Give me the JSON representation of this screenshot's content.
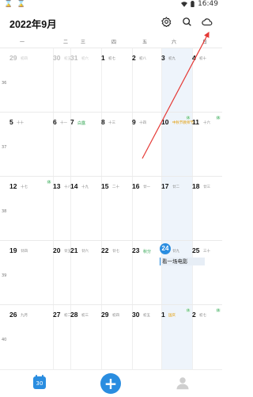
{
  "status_bar": {
    "left_icons": "⌛ ⌛",
    "time": "16:49"
  },
  "header": {
    "title": "2022年9月",
    "icons": [
      "settings-icon",
      "search-icon",
      "cloud-icon"
    ]
  },
  "weekdays": [
    "一",
    "二",
    "三",
    "四",
    "五",
    "六",
    "日"
  ],
  "weeks": [
    {
      "num": "36",
      "days": [
        {
          "day": "29",
          "lunar": "初四",
          "muted": true
        },
        {
          "day": "30",
          "lunar": "初五",
          "muted": true
        },
        {
          "day": "31",
          "lunar": "初六",
          "muted": true
        },
        {
          "day": "1",
          "lunar": "初七"
        },
        {
          "day": "2",
          "lunar": "初八"
        },
        {
          "day": "3",
          "lunar": "初九"
        },
        {
          "day": "4",
          "lunar": "初十"
        }
      ]
    },
    {
      "num": "37",
      "days": [
        {
          "day": "5",
          "lunar": "十十"
        },
        {
          "day": "6",
          "lunar": "十一"
        },
        {
          "day": "7",
          "lunar": "白露",
          "type": "festival"
        },
        {
          "day": "8",
          "lunar": "十三"
        },
        {
          "day": "9",
          "lunar": "十四"
        },
        {
          "day": "10",
          "lunar": "中秋节教师节",
          "type": "holiday",
          "badge": "休",
          "badge_type": "xiu"
        },
        {
          "day": "11",
          "lunar": "十六",
          "badge": "休",
          "badge_type": "xiu"
        }
      ]
    },
    {
      "num": "38",
      "days": [
        {
          "day": "12",
          "lunar": "十七",
          "badge": "休",
          "badge_type": "xiu"
        },
        {
          "day": "13",
          "lunar": "十八"
        },
        {
          "day": "14",
          "lunar": "十九"
        },
        {
          "day": "15",
          "lunar": "二十"
        },
        {
          "day": "16",
          "lunar": "廿一"
        },
        {
          "day": "17",
          "lunar": "廿二"
        },
        {
          "day": "18",
          "lunar": "廿三"
        }
      ]
    },
    {
      "num": "39",
      "days": [
        {
          "day": "19",
          "lunar": "廿四"
        },
        {
          "day": "20",
          "lunar": "廿五"
        },
        {
          "day": "21",
          "lunar": "廿六"
        },
        {
          "day": "22",
          "lunar": "廿七"
        },
        {
          "day": "23",
          "lunar": "秋分",
          "type": "festival"
        },
        {
          "day": "24",
          "lunar": "廿九",
          "today": true,
          "event": "看一场电影"
        },
        {
          "day": "25",
          "lunar": "三十"
        }
      ]
    },
    {
      "num": "40",
      "days": [
        {
          "day": "26",
          "lunar": "九月"
        },
        {
          "day": "27",
          "lunar": "初二"
        },
        {
          "day": "28",
          "lunar": "初三"
        },
        {
          "day": "29",
          "lunar": "初四"
        },
        {
          "day": "30",
          "lunar": "初五"
        },
        {
          "day": "1",
          "lunar": "国庆",
          "type": "holiday",
          "badge": "休",
          "badge_type": "xiu",
          "muted_day": true
        },
        {
          "day": "2",
          "lunar": "初七",
          "badge": "休",
          "badge_type": "xiu",
          "muted_day": true
        }
      ]
    }
  ],
  "bottom_bar": {
    "calendar_tab_label": "30",
    "add_label": "+"
  },
  "colors": {
    "accent": "#2a8de0",
    "festival": "#2ea44f",
    "holiday": "#e39b00",
    "annotation": "#e53935"
  }
}
